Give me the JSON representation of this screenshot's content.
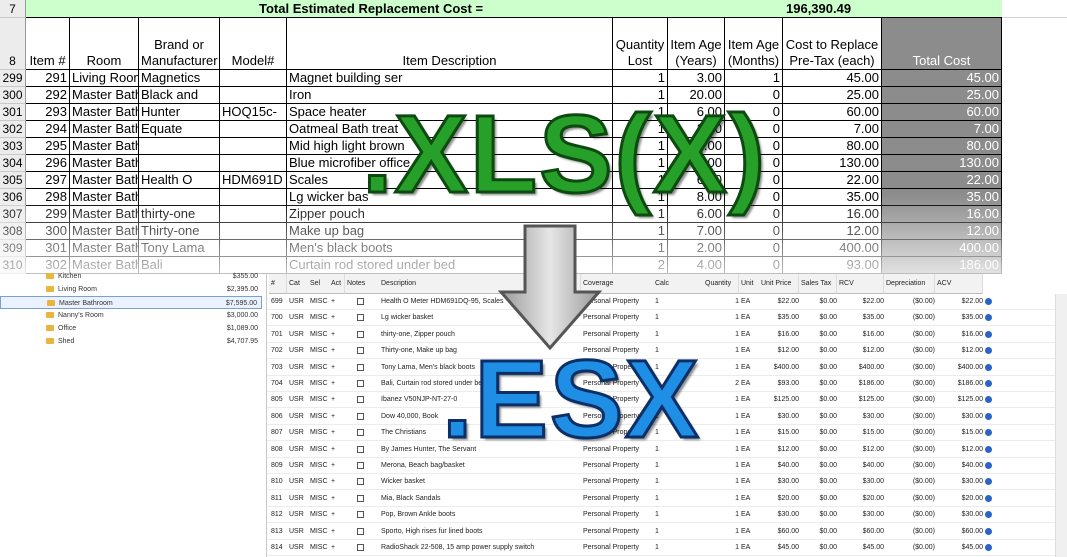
{
  "spreadsheet": {
    "title_row_number": "7",
    "header_row_number": "8",
    "total_label": "Total Estimated Replacement Cost =",
    "total_value": "196,390.49",
    "columns": {
      "item": "Item #",
      "room": "Room",
      "brand": "Brand or Manufacturer",
      "model": "Model#",
      "desc": "Item Description",
      "qty": "Quantity Lost",
      "age_years": "Item Age (Years)",
      "age_months": "Item Age (Months)",
      "cost": "Cost to Replace Pre-Tax (each)",
      "total": "Total Cost"
    },
    "rows": [
      {
        "rownum": "299",
        "item": "291",
        "room": "Living Room",
        "brand": "Magnetics",
        "model": "",
        "desc": "Magnet building ser",
        "qty": "1",
        "years": "3.00",
        "months": "1",
        "cost": "45.00",
        "total": "45.00"
      },
      {
        "rownum": "300",
        "item": "292",
        "room": "Master Bath",
        "brand": "Black and",
        "model": "",
        "desc": "Iron",
        "qty": "1",
        "years": "20.00",
        "months": "0",
        "cost": "25.00",
        "total": "25.00"
      },
      {
        "rownum": "301",
        "item": "293",
        "room": "Master Bath",
        "brand": "Hunter",
        "model": "HOQ15c-",
        "desc": "Space heater",
        "qty": "1",
        "years": "6.00",
        "months": "0",
        "cost": "60.00",
        "total": "60.00"
      },
      {
        "rownum": "302",
        "item": "294",
        "room": "Master Bath",
        "brand": "Equate",
        "model": "",
        "desc": "Oatmeal Bath treat",
        "qty": "1",
        "years": "2.00",
        "months": "0",
        "cost": "7.00",
        "total": "7.00"
      },
      {
        "rownum": "303",
        "item": "295",
        "room": "Master Bathroom",
        "brand": "",
        "model": "",
        "desc": "Mid high light brown",
        "qty": "1",
        "years": "4.00",
        "months": "0",
        "cost": "80.00",
        "total": "80.00"
      },
      {
        "rownum": "304",
        "item": "296",
        "room": "Master Bathroom",
        "brand": "",
        "model": "",
        "desc": "Blue microfiber office",
        "qty": "1",
        "years": "2.00",
        "months": "0",
        "cost": "130.00",
        "total": "130.00"
      },
      {
        "rownum": "305",
        "item": "297",
        "room": "Master Bath",
        "brand": "Health O",
        "model": "HDM691D",
        "desc": "Scales",
        "qty": "1",
        "years": "6.00",
        "months": "0",
        "cost": "22.00",
        "total": "22.00"
      },
      {
        "rownum": "306",
        "item": "298",
        "room": "Master Bathroom",
        "brand": "",
        "model": "",
        "desc": "Lg wicker bas",
        "qty": "1",
        "years": "8.00",
        "months": "0",
        "cost": "35.00",
        "total": "35.00"
      },
      {
        "rownum": "307",
        "item": "299",
        "room": "Master Bath",
        "brand": "thirty-one",
        "model": "",
        "desc": "Zipper pouch",
        "qty": "1",
        "years": "6.00",
        "months": "0",
        "cost": "16.00",
        "total": "16.00"
      },
      {
        "rownum": "308",
        "item": "300",
        "room": "Master Bath",
        "brand": "Thirty-one",
        "model": "",
        "desc": "Make up bag",
        "qty": "1",
        "years": "7.00",
        "months": "0",
        "cost": "12.00",
        "total": "12.00"
      },
      {
        "rownum": "309",
        "item": "301",
        "room": "Master Bath",
        "brand": "Tony Lama",
        "model": "",
        "desc": "Men's black boots",
        "qty": "1",
        "years": "2.00",
        "months": "0",
        "cost": "400.00",
        "total": "400.00"
      },
      {
        "rownum": "310",
        "item": "302",
        "room": "Master Bath",
        "brand": "Bali",
        "model": "",
        "desc": "Curtain rod stored under bed",
        "qty": "2",
        "years": "4.00",
        "months": "0",
        "cost": "93.00",
        "total": "186.00"
      }
    ]
  },
  "folders": [
    {
      "name": "Kitchen",
      "value": "$355.00"
    },
    {
      "name": "Living Room",
      "value": "$2,395.00"
    },
    {
      "name": "Master Bathroom",
      "value": "$7,595.00",
      "selected": true
    },
    {
      "name": "Nanny's Room",
      "value": "$3,000.00"
    },
    {
      "name": "Office",
      "value": "$1,089.00"
    },
    {
      "name": "Shed",
      "value": "$4,707.95"
    }
  ],
  "esx_grid": {
    "columns": [
      "#",
      "Cat",
      "Sel",
      "Act",
      "Notes",
      "Description",
      "Coverage",
      "Calc",
      "Quantity",
      "Unit",
      "Unit Price",
      "Sales Tax",
      "RCV",
      "Depreciation",
      "ACV"
    ],
    "rows": [
      {
        "num": "699",
        "cat": "USR",
        "sel": "MISC",
        "act": "+",
        "desc": "Health O Meter HDM691DQ-95, Scales",
        "cov": "Personal Property",
        "calc": "1",
        "qty": "1",
        "unit": "EA",
        "price": "$22.00",
        "tax": "$0.00",
        "rcv": "$22.00",
        "dep": "($0.00)",
        "acv": "$22.00"
      },
      {
        "num": "700",
        "cat": "USR",
        "sel": "MISC",
        "act": "+",
        "desc": "Lg wicker basket",
        "cov": "Personal Property",
        "calc": "1",
        "qty": "1",
        "unit": "EA",
        "price": "$35.00",
        "tax": "$0.00",
        "rcv": "$35.00",
        "dep": "($0.00)",
        "acv": "$35.00"
      },
      {
        "num": "701",
        "cat": "USR",
        "sel": "MISC",
        "act": "+",
        "desc": "thirty-one, Zipper pouch",
        "cov": "Personal Property",
        "calc": "1",
        "qty": "1",
        "unit": "EA",
        "price": "$16.00",
        "tax": "$0.00",
        "rcv": "$16.00",
        "dep": "($0.00)",
        "acv": "$16.00"
      },
      {
        "num": "702",
        "cat": "USR",
        "sel": "MISC",
        "act": "+",
        "desc": "Thirty-one, Make up bag",
        "cov": "Personal Property",
        "calc": "1",
        "qty": "1",
        "unit": "EA",
        "price": "$12.00",
        "tax": "$0.00",
        "rcv": "$12.00",
        "dep": "($0.00)",
        "acv": "$12.00"
      },
      {
        "num": "703",
        "cat": "USR",
        "sel": "MISC",
        "act": "+",
        "desc": "Tony Lama, Men's black boots",
        "cov": "Personal Property",
        "calc": "1",
        "qty": "1",
        "unit": "EA",
        "price": "$400.00",
        "tax": "$0.00",
        "rcv": "$400.00",
        "dep": "($0.00)",
        "acv": "$400.00"
      },
      {
        "num": "704",
        "cat": "USR",
        "sel": "MISC",
        "act": "+",
        "desc": "Bali, Curtain rod stored under bed",
        "cov": "Personal Property",
        "calc": "2",
        "qty": "2",
        "unit": "EA",
        "price": "$93.00",
        "tax": "$0.00",
        "rcv": "$186.00",
        "dep": "($0.00)",
        "acv": "$186.00"
      },
      {
        "num": "805",
        "cat": "USR",
        "sel": "MISC",
        "act": "+",
        "desc": "Ibanez V50NJP-NT-27-0",
        "cov": "Personal Property",
        "calc": "1",
        "qty": "1",
        "unit": "EA",
        "price": "$125.00",
        "tax": "$0.00",
        "rcv": "$125.00",
        "dep": "($0.00)",
        "acv": "$125.00"
      },
      {
        "num": "806",
        "cat": "USR",
        "sel": "MISC",
        "act": "+",
        "desc": "Dow 40,000, Book",
        "cov": "Personal Property",
        "calc": "1",
        "qty": "1",
        "unit": "EA",
        "price": "$30.00",
        "tax": "$0.00",
        "rcv": "$30.00",
        "dep": "($0.00)",
        "acv": "$30.00"
      },
      {
        "num": "807",
        "cat": "USR",
        "sel": "MISC",
        "act": "+",
        "desc": "The Christians",
        "cov": "Personal Property",
        "calc": "1",
        "qty": "1",
        "unit": "EA",
        "price": "$15.00",
        "tax": "$0.00",
        "rcv": "$15.00",
        "dep": "($0.00)",
        "acv": "$15.00"
      },
      {
        "num": "808",
        "cat": "USR",
        "sel": "MISC",
        "act": "+",
        "desc": "By James Hunter, The Servant",
        "cov": "Personal Property",
        "calc": "1",
        "qty": "1",
        "unit": "EA",
        "price": "$12.00",
        "tax": "$0.00",
        "rcv": "$12.00",
        "dep": "($0.00)",
        "acv": "$12.00"
      },
      {
        "num": "809",
        "cat": "USR",
        "sel": "MISC",
        "act": "+",
        "desc": "Merona, Beach bag/basket",
        "cov": "Personal Property",
        "calc": "1",
        "qty": "1",
        "unit": "EA",
        "price": "$40.00",
        "tax": "$0.00",
        "rcv": "$40.00",
        "dep": "($0.00)",
        "acv": "$40.00"
      },
      {
        "num": "810",
        "cat": "USR",
        "sel": "MISC",
        "act": "+",
        "desc": "Wicker basket",
        "cov": "Personal Property",
        "calc": "1",
        "qty": "1",
        "unit": "EA",
        "price": "$30.00",
        "tax": "$0.00",
        "rcv": "$30.00",
        "dep": "($0.00)",
        "acv": "$30.00"
      },
      {
        "num": "811",
        "cat": "USR",
        "sel": "MISC",
        "act": "+",
        "desc": "Mia, Black Sandals",
        "cov": "Personal Property",
        "calc": "1",
        "qty": "1",
        "unit": "EA",
        "price": "$20.00",
        "tax": "$0.00",
        "rcv": "$20.00",
        "dep": "($0.00)",
        "acv": "$20.00"
      },
      {
        "num": "812",
        "cat": "USR",
        "sel": "MISC",
        "act": "+",
        "desc": "Pop, Brown Ankle boots",
        "cov": "Personal Property",
        "calc": "1",
        "qty": "1",
        "unit": "EA",
        "price": "$30.00",
        "tax": "$0.00",
        "rcv": "$30.00",
        "dep": "($0.00)",
        "acv": "$30.00"
      },
      {
        "num": "813",
        "cat": "USR",
        "sel": "MISC",
        "act": "+",
        "desc": "Sporto, High rises fur lined boots",
        "cov": "Personal Property",
        "calc": "1",
        "qty": "1",
        "unit": "EA",
        "price": "$60.00",
        "tax": "$0.00",
        "rcv": "$60.00",
        "dep": "($0.00)",
        "acv": "$60.00"
      },
      {
        "num": "814",
        "cat": "USR",
        "sel": "MISC",
        "act": "+",
        "desc": "RadioShack 22-508, 15 amp power supply switch",
        "cov": "Personal Property",
        "calc": "1",
        "qty": "1",
        "unit": "EA",
        "price": "$45.00",
        "tax": "$0.00",
        "rcv": "$45.00",
        "dep": "($0.00)",
        "acv": "$45.00"
      }
    ]
  },
  "overlay": {
    "xls_label": ".XLS(X)",
    "esx_label": ".ESX",
    "xls_color": "#27a02a",
    "esx_color": "#1f8fe6",
    "arrow_color": "#c0c0c0",
    "arrow_icon": "down-arrow-icon"
  }
}
